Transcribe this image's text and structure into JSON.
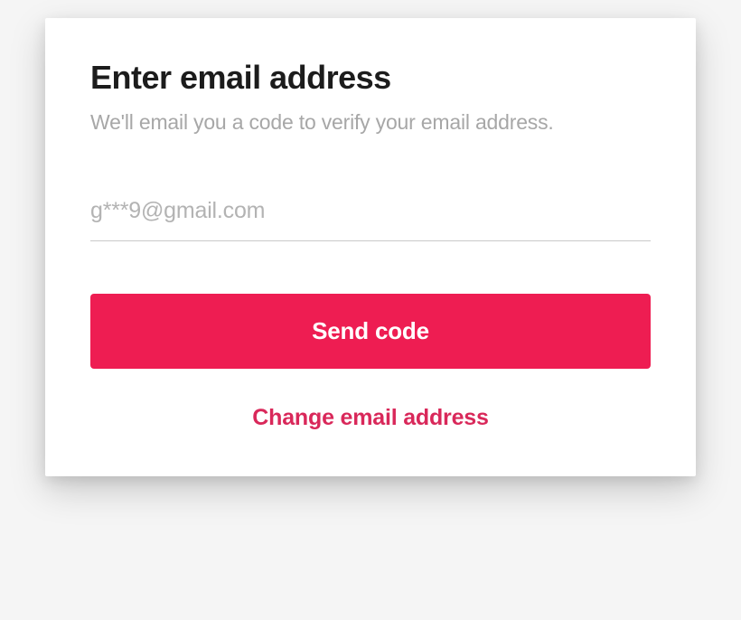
{
  "dialog": {
    "title": "Enter email address",
    "subtitle": "We'll email you a code to verify your email address.",
    "email_placeholder": "g***9@gmail.com",
    "send_button_label": "Send code",
    "change_link_label": "Change email address"
  }
}
